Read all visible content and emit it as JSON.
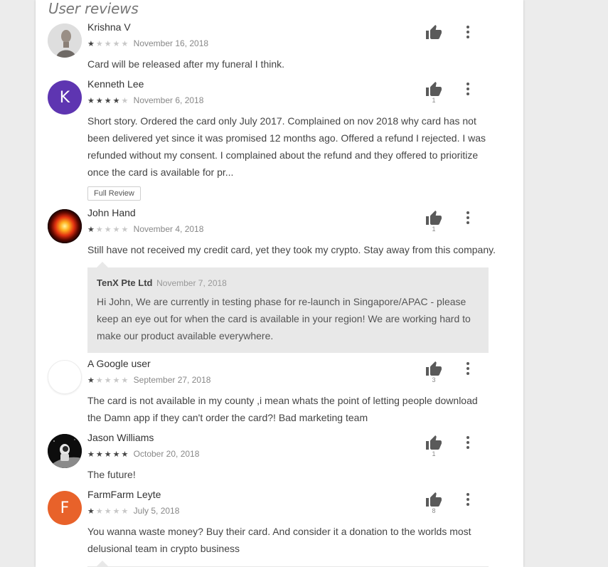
{
  "section_title": "User reviews",
  "reviews": [
    {
      "author": "Krishna V",
      "rating": 1,
      "date": "November 16, 2018",
      "text": "Card will be released after my funeral I think.",
      "helpful_count": "",
      "avatar_type": "photo-person"
    },
    {
      "author": "Kenneth Lee",
      "rating": 4,
      "date": "November 6, 2018",
      "text": "Short story. Ordered the card only July 2017. Complained on nov 2018 why card has not been delivered yet since it was promised 12 months ago. Offered a refund I rejected. I was refunded without my consent. I complained about the refund and they offered to prioritize once the card is available for pr...",
      "helpful_count": "1",
      "avatar_letter": "K",
      "avatar_color": "#5e35b1",
      "full_review_label": "Full Review"
    },
    {
      "author": "John Hand",
      "rating": 1,
      "date": "November 4, 2018",
      "text": "Still have not received my credit card, yet they took my crypto. Stay away from this company.",
      "helpful_count": "1",
      "avatar_type": "photo-glow"
    },
    {
      "author": "A Google user",
      "rating": 1,
      "date": "September 27, 2018",
      "text": "The card is not available in my county ,i mean whats the point of letting people download the Damn app if they can't order the card?! Bad marketing team",
      "helpful_count": "3",
      "avatar_type": "blank"
    },
    {
      "author": "Jason Williams",
      "rating": 5,
      "date": "October 20, 2018",
      "text": "The future!",
      "helpful_count": "1",
      "avatar_type": "photo-astronaut"
    },
    {
      "author": "FarmFarm Leyte",
      "rating": 1,
      "date": "July 5, 2018",
      "text": "You wanna waste money? Buy their card. And consider it a donation to the worlds most delusional team in crypto business",
      "helpful_count": "8",
      "avatar_letter": "F",
      "avatar_color": "#e8622a"
    }
  ],
  "developer_reply": {
    "author": "TenX Pte Ltd",
    "date": "November 7, 2018",
    "text": "Hi John, We are currently in testing phase for re-launch in Singapore/APAC - please keep an eye out for when the card is available in your region! We are working hard to make our product available everywhere."
  },
  "icons": {
    "thumb": "thumbs-up-icon",
    "more": "more-vert-icon",
    "star": "star-icon"
  },
  "colors": {
    "star_filled": "#444444",
    "star_empty": "#c8c8c8",
    "reply_bg": "#e8e8e8"
  }
}
